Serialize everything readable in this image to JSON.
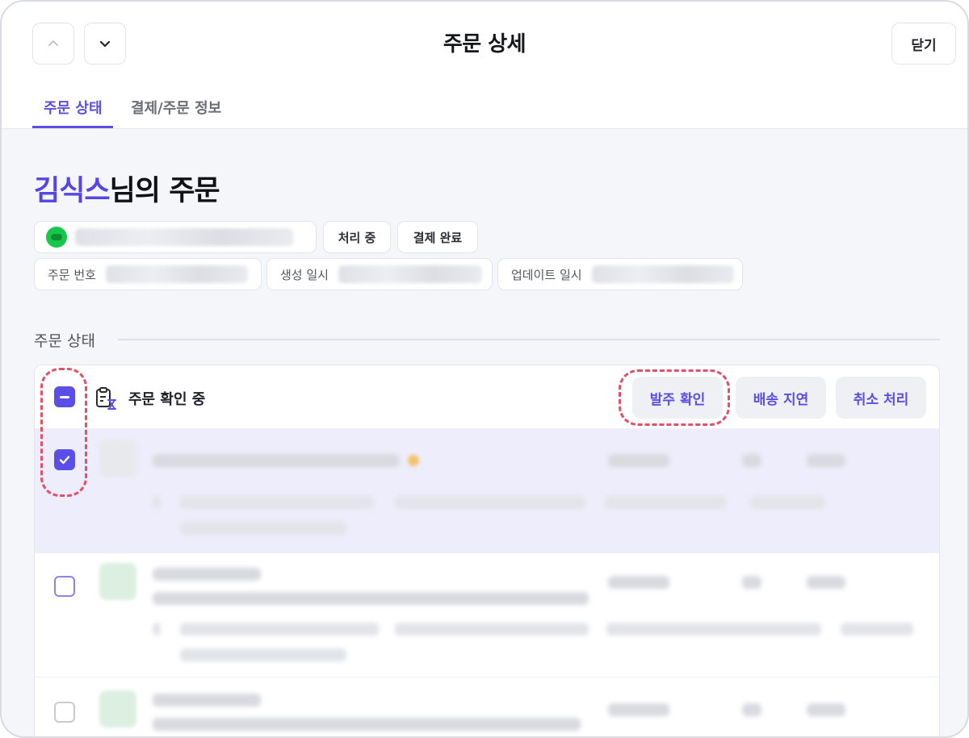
{
  "header": {
    "title": "주문 상세",
    "close_label": "닫기",
    "prev_icon": "chevron-up-icon",
    "next_icon": "chevron-down-icon"
  },
  "tabs": [
    {
      "label": "주문 상태",
      "active": true
    },
    {
      "label": "결제/주문 정보",
      "active": false
    }
  ],
  "customer": {
    "name": "김식스",
    "suffix": "님의 주문"
  },
  "chips": {
    "payment_icon": "pay-logo-icon",
    "status_processing": "처리 중",
    "status_paid": "결제 완료",
    "order_number_label": "주문 번호",
    "created_label": "생성 일시",
    "updated_label": "업데이트 일시"
  },
  "section": {
    "title": "주문 상태"
  },
  "group": {
    "title": "주문 확인 중",
    "icon": "clipboard-hourglass-icon",
    "actions": [
      "발주 확인",
      "배송 지연",
      "취소 처리"
    ]
  },
  "colors": {
    "accent": "#5b4ee8",
    "highlight_dash": "#e2506a",
    "selected_row": "#eeedfb"
  }
}
